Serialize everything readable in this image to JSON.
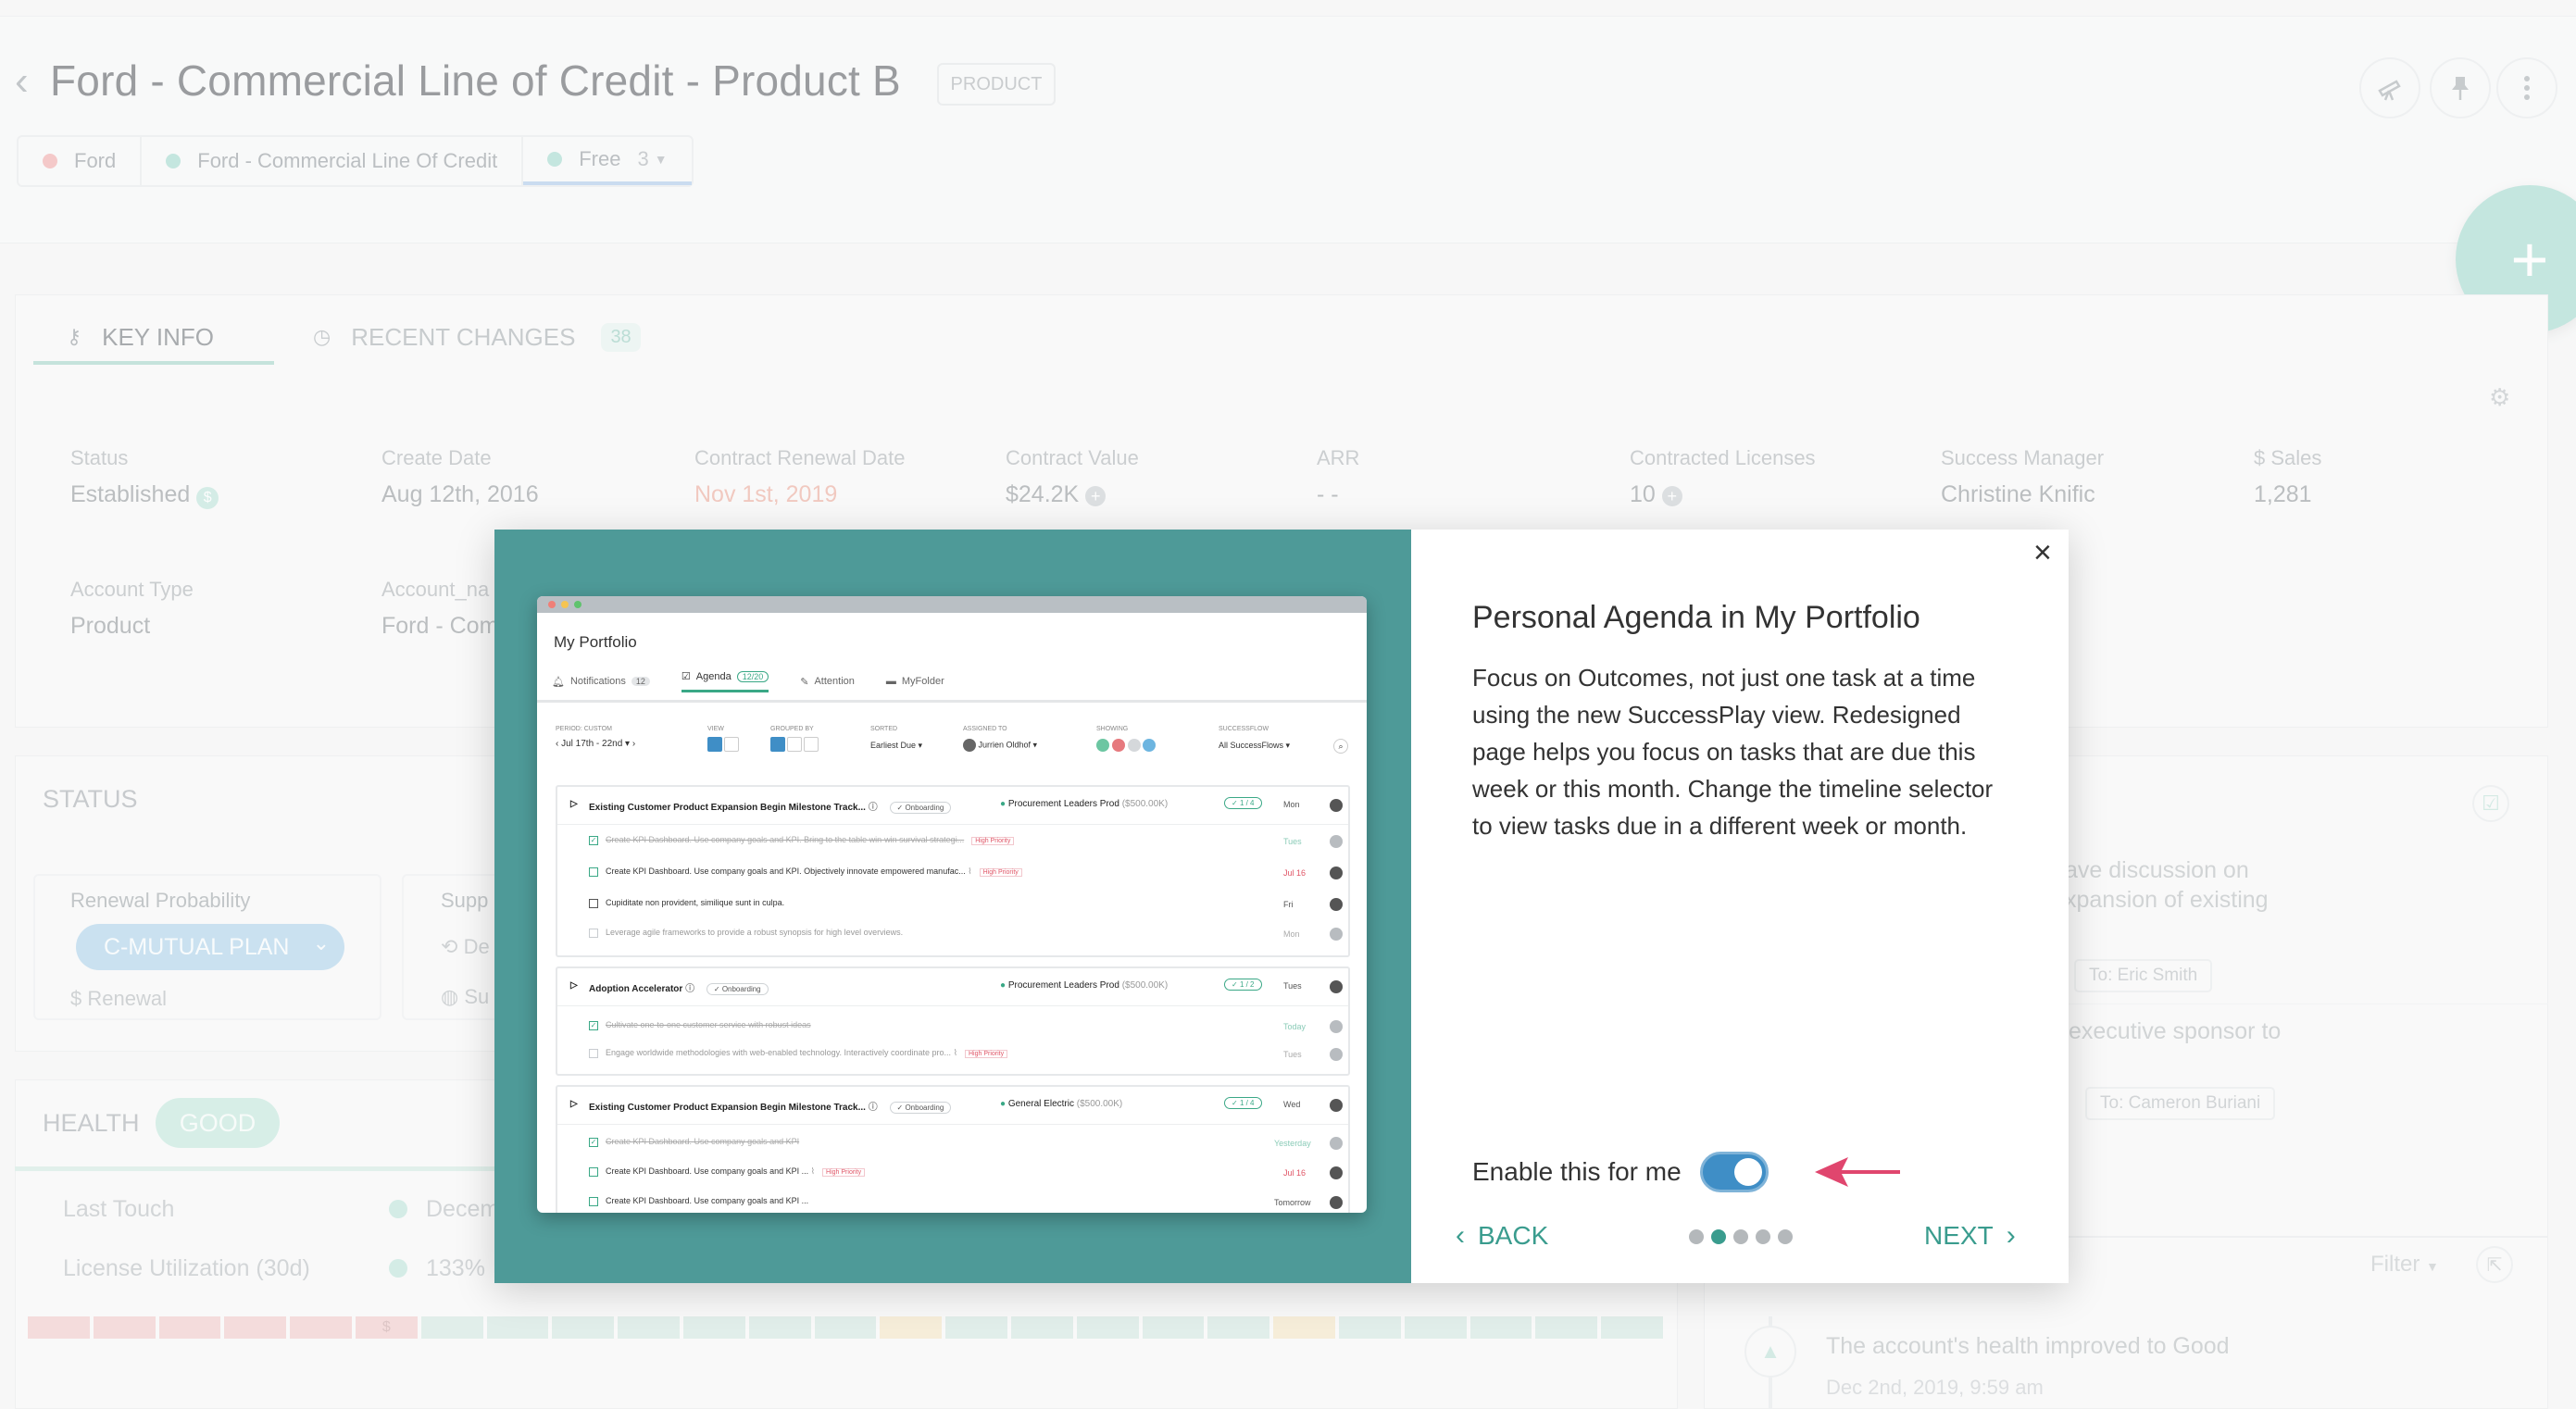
{
  "header": {
    "title": "Ford - Commercial Line of Credit - Product B",
    "badge": "PRODUCT",
    "breadcrumbs": [
      {
        "label": "Ford",
        "color": "#f0a5a5"
      },
      {
        "label": "Ford - Commercial Line Of Credit",
        "color": "#9ed7cb"
      },
      {
        "label": "Free",
        "color": "#9ed7cb",
        "count": "3"
      }
    ],
    "fab_label": "+"
  },
  "key_info": {
    "tab_key": "KEY INFO",
    "tab_recent": "RECENT CHANGES",
    "recent_count": "38",
    "fields": [
      {
        "label": "Status",
        "value": "Established"
      },
      {
        "label": "Create Date",
        "value": "Aug 12th, 2016"
      },
      {
        "label": "Contract Renewal Date",
        "value": "Nov 1st, 2019"
      },
      {
        "label": "Contract Value",
        "value": "$24.2K"
      },
      {
        "label": "ARR",
        "value": "- -"
      },
      {
        "label": "Contracted Licenses",
        "value": "10"
      },
      {
        "label": "Success Manager",
        "value": "Christine Knific"
      },
      {
        "label": "$ Sales",
        "value": "1,281"
      },
      {
        "label": "Account Type",
        "value": "Product"
      },
      {
        "label": "Account_na",
        "value": "Ford - Com"
      }
    ]
  },
  "status": {
    "title": "STATUS",
    "renewal_label": "Renewal Probability",
    "plan": "C-MUTUAL PLAN",
    "renewal_sub": "$ Renewal",
    "support_label": "Supp",
    "support_items": [
      "De",
      "Su"
    ]
  },
  "health": {
    "title": "HEALTH",
    "badge": "GOOD",
    "rows": [
      {
        "label": "Last Touch",
        "value": "Decem"
      },
      {
        "label": "License Utilization (30d)",
        "value": "133%"
      }
    ],
    "bar_marker": "$"
  },
  "right_panel": {
    "items": [
      {
        "text1": "ave discussion on",
        "text2": "xpansion of existing",
        "to": "To: Eric Smith"
      },
      {
        "text1": "executive sponsor to",
        "text2": "",
        "to": "To: Cameron Buriani"
      }
    ],
    "filter": "Filter",
    "timeline_text": "The account's health improved to Good",
    "timeline_date": "Dec 2nd, 2019, 9:59 am"
  },
  "modal": {
    "heading": "Personal Agenda in My Portfolio",
    "body": "Focus on Outcomes, not just one task at a time using the new SuccessPlay view. Redesigned page helps you focus on tasks that are due this week or this month. Change the timeline selector to view tasks due in a different week or month.",
    "enable_label": "Enable this for me",
    "toggle_on": true,
    "back_label": "BACK",
    "next_label": "NEXT",
    "step_count": 5,
    "current_step": 2,
    "close_label": "×"
  },
  "preview": {
    "title": "My Portfolio",
    "tabs": [
      {
        "label": "Notifications",
        "badge": "12"
      },
      {
        "label": "Agenda",
        "badge": "12/20"
      },
      {
        "label": "Attention",
        "badge": ""
      },
      {
        "label": "MyFolder",
        "badge": ""
      }
    ],
    "filters": [
      {
        "label": "PERIOD: CUSTOM",
        "value": "Jul 17th - 22nd"
      },
      {
        "label": "VIEW",
        "value": ""
      },
      {
        "label": "GROUPED BY",
        "value": ""
      },
      {
        "label": "SORTED",
        "value": "Earliest Due"
      },
      {
        "label": "ASSIGNED TO",
        "value": "Jurrien Oldhof"
      },
      {
        "label": "SHOWING",
        "value": ""
      },
      {
        "label": "SUCCESSFLOW",
        "value": "All SuccessFlows"
      }
    ],
    "groups": [
      {
        "title": "Existing Customer Product Expansion Begin Milestone Track...",
        "tag": "Onboarding",
        "account": "Procurement Leaders Prod",
        "amount": "($500.00K)",
        "progress": "1 / 4",
        "day": "Mon",
        "tasks": [
          {
            "text": "Create KPI Dashboard. Use company goals and KPI. Bring to the table win-win survival strategi...",
            "done": true,
            "priority": "High Priority",
            "day": "Tues"
          },
          {
            "text": "Create KPI Dashboard. Use company goals and KPI. Objectively innovate empowered manufac...",
            "done": false,
            "priority": "High Priority",
            "day": "Jul 16"
          },
          {
            "text": "Cupiditate non provident, similique sunt in culpa.",
            "done": false,
            "priority": "",
            "day": "Fri"
          },
          {
            "text": "Leverage agile frameworks to provide a robust synopsis for high level overviews.",
            "done": false,
            "priority": "",
            "day": "Mon"
          }
        ]
      },
      {
        "title": "Adoption Accelerator",
        "tag": "Onboarding",
        "account": "Procurement Leaders Prod",
        "amount": "($500.00K)",
        "progress": "1 / 2",
        "day": "Tues",
        "tasks": [
          {
            "text": "Cultivate one-to-one customer service with robust ideas",
            "done": true,
            "priority": "",
            "day": "Today"
          },
          {
            "text": "Engage worldwide methodologies with web-enabled technology. Interactively coordinate pro...",
            "done": false,
            "priority": "High Priority",
            "day": "Tues"
          }
        ]
      },
      {
        "title": "Existing Customer Product Expansion Begin Milestone Track...",
        "tag": "Onboarding",
        "account": "General Electric",
        "amount": "($500.00K)",
        "progress": "1 / 4",
        "day": "Wed",
        "tasks": [
          {
            "text": "Create KPI Dashboard. Use company goals and KPI",
            "done": true,
            "priority": "",
            "day": "Yesterday"
          },
          {
            "text": "Create KPI Dashboard. Use company goals and KPI ...",
            "done": false,
            "priority": "High Priority",
            "day": "Jul 16"
          },
          {
            "text": "Create KPI Dashboard. Use company goals and KPI ...",
            "done": false,
            "priority": "",
            "day": "Tomorrow"
          }
        ]
      }
    ]
  },
  "colors": {
    "teal": "#4e9a98",
    "accent": "#3a9c8e",
    "toggle": "#3f8ec6",
    "arrow": "#e0466e"
  }
}
